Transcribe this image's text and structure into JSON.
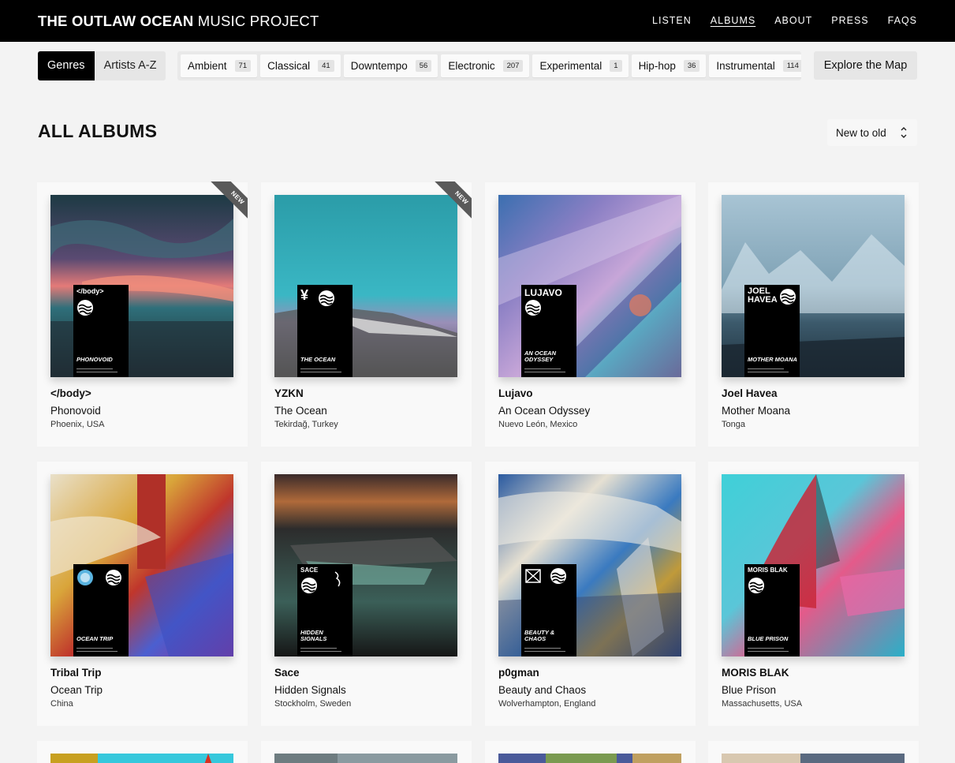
{
  "header": {
    "logo_bold": "THE OUTLAW OCEAN",
    "logo_light": "MUSIC PROJECT",
    "nav": [
      "LISTEN",
      "ALBUMS",
      "ABOUT",
      "PRESS",
      "FAQS"
    ],
    "active_nav": "ALBUMS"
  },
  "filters": {
    "segment": [
      "Genres",
      "Artists A-Z"
    ],
    "genres": [
      {
        "name": "Ambient",
        "count": "71"
      },
      {
        "name": "Classical",
        "count": "41"
      },
      {
        "name": "Downtempo",
        "count": "56"
      },
      {
        "name": "Electronic",
        "count": "207"
      },
      {
        "name": "Experimental",
        "count": "1"
      },
      {
        "name": "Hip-hop",
        "count": "36"
      },
      {
        "name": "Instrumental",
        "count": "114"
      }
    ],
    "explore_label": "Explore the Map"
  },
  "section": {
    "title_bold": "ALL",
    "title_light": "ALBUMS",
    "sort_label": "New to old"
  },
  "ribbon_label": "NEW",
  "albums": [
    {
      "artist": "</body>",
      "title": "Phonovoid",
      "origin": "Phoenix, USA",
      "plate_top": "</body>",
      "plate_title": "PHONOVOID",
      "is_new": true
    },
    {
      "artist": "YZKN",
      "title": "The Ocean",
      "origin": "Tekirdağ, Turkey",
      "plate_top": "¥",
      "plate_title": "THE OCEAN",
      "is_new": true
    },
    {
      "artist": "Lujavo",
      "title": "An Ocean Odyssey",
      "origin": "Nuevo León, Mexico",
      "plate_top": "LUJAVO",
      "plate_title": "AN OCEAN ODYSSEY",
      "is_new": false
    },
    {
      "artist": "Joel Havea",
      "title": "Mother Moana",
      "origin": "Tonga",
      "plate_top": "JOEL HAVEA",
      "plate_title": "MOTHER MOANA",
      "is_new": false
    },
    {
      "artist": "Tribal Trip",
      "title": "Ocean Trip",
      "origin": "China",
      "plate_top": "",
      "plate_title": "OCEAN TRIP",
      "is_new": false
    },
    {
      "artist": "Sace",
      "title": "Hidden Signals",
      "origin": "Stockholm, Sweden",
      "plate_top": "SACE",
      "plate_title": "HIDDEN SIGNALS",
      "is_new": false
    },
    {
      "artist": "p0gman",
      "title": "Beauty and Chaos",
      "origin": "Wolverhampton, England",
      "plate_top": "",
      "plate_title": "BEAUTY & CHAOS",
      "is_new": false
    },
    {
      "artist": "MORIS BLAK",
      "title": "Blue Prison",
      "origin": "Massachusetts, USA",
      "plate_top": "MORIS BLAK",
      "plate_title": "BLUE PRISON",
      "is_new": false
    }
  ],
  "colors": {
    "header_bg": "#000000",
    "page_bg": "#f3f3f3",
    "card_bg": "#f9f9f9",
    "ribbon": "#5a5a5a"
  }
}
